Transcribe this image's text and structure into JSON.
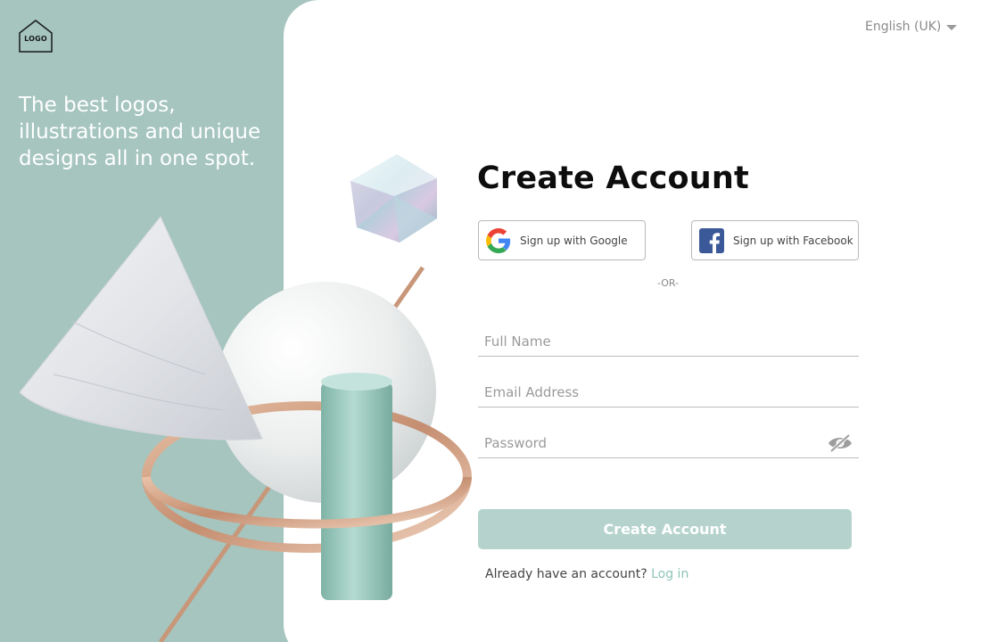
{
  "brand": {
    "logo_text": "LOGO"
  },
  "hero": {
    "tagline": "The best logos, illustrations and unique designs all in one spot."
  },
  "language": {
    "selected": "English (UK)"
  },
  "form": {
    "title": "Create Account",
    "google_label": "Sign up with Google",
    "facebook_label": "Sign up with Facebook",
    "divider": "-OR-",
    "full_name_placeholder": "Full Name",
    "email_placeholder": "Email Address",
    "password_placeholder": "Password",
    "submit_label": "Create Account",
    "login_prompt": "Already have an account?",
    "login_link": "Log in"
  },
  "colors": {
    "panel": "#a5c5be",
    "button": "#b5d3cc",
    "link": "#8ec4b8"
  },
  "icons": [
    "house-logo-icon",
    "chevron-down-icon",
    "google-icon",
    "facebook-icon",
    "eye-slash-icon"
  ]
}
